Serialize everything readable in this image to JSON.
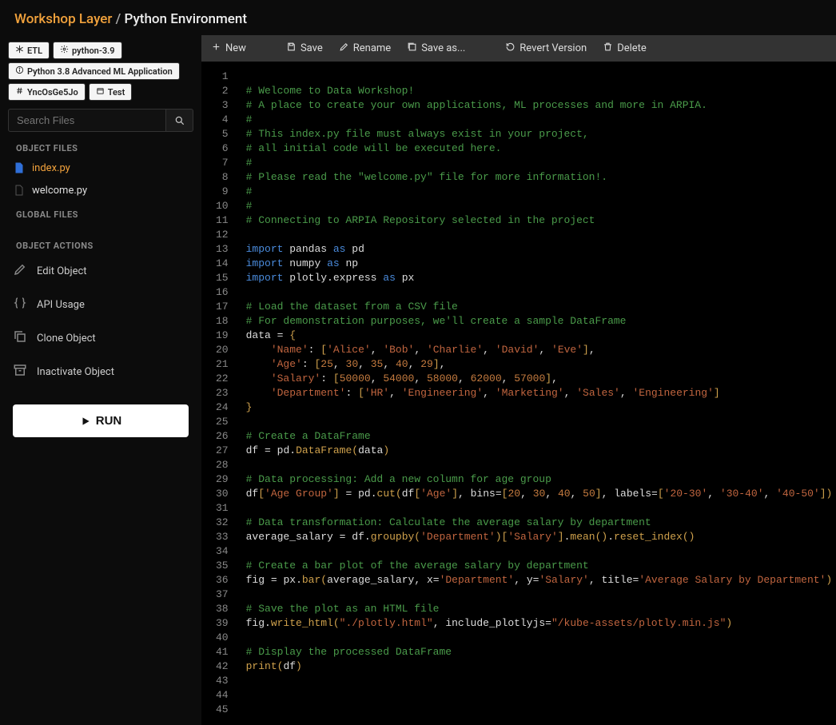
{
  "header": {
    "crumb1": "Workshop Layer",
    "crumb2": "Python Environment"
  },
  "tags": [
    {
      "icon": "snowflake",
      "label": "ETL"
    },
    {
      "icon": "gear",
      "label": "python-3.9"
    },
    {
      "icon": "info",
      "label": "Python 3.8 Advanced ML Application"
    },
    {
      "icon": "hash",
      "label": "YncOsGe5Jo"
    },
    {
      "icon": "box",
      "label": "Test"
    }
  ],
  "search": {
    "placeholder": "Search Files"
  },
  "sections": {
    "objectFiles": "Object Files",
    "globalFiles": "Global Files",
    "objectActions": "Object Actions"
  },
  "files": [
    {
      "name": "index.py",
      "active": true,
      "color": "#2f6fd8"
    },
    {
      "name": "welcome.py",
      "active": false,
      "color": "#555"
    }
  ],
  "actions": [
    {
      "icon": "pencil",
      "label": "Edit Object"
    },
    {
      "icon": "braces",
      "label": "API Usage"
    },
    {
      "icon": "copy",
      "label": "Clone Object"
    },
    {
      "icon": "archive",
      "label": "Inactivate Object"
    }
  ],
  "runLabel": "RUN",
  "toolbar": [
    {
      "icon": "plus",
      "label": "New"
    },
    {
      "icon": "save",
      "label": "Save"
    },
    {
      "icon": "pencil",
      "label": "Rename"
    },
    {
      "icon": "saveas",
      "label": "Save as..."
    },
    {
      "icon": "revert",
      "label": "Revert Version"
    },
    {
      "icon": "trash",
      "label": "Delete"
    }
  ],
  "code": [
    {
      "n": 1,
      "t": ""
    },
    {
      "n": 2,
      "t": "<span class='c-com'># Welcome to Data Workshop!</span>"
    },
    {
      "n": 3,
      "t": "<span class='c-com'># A place to create your own applications, ML processes and more in ARPIA.</span>"
    },
    {
      "n": 4,
      "t": "<span class='c-com'>#</span>"
    },
    {
      "n": 5,
      "t": "<span class='c-com'># This index.py file must always exist in your project,</span>"
    },
    {
      "n": 6,
      "t": "<span class='c-com'># all initial code will be executed here.</span>"
    },
    {
      "n": 7,
      "t": "<span class='c-com'>#</span>"
    },
    {
      "n": 8,
      "t": "<span class='c-com'># Please read the \"welcome.py\" file for more information!.</span>"
    },
    {
      "n": 9,
      "t": "<span class='c-com'>#</span>"
    },
    {
      "n": 10,
      "t": "<span class='c-com'>#</span>"
    },
    {
      "n": 11,
      "t": "<span class='c-com'># Connecting to ARPIA Repository selected in the project</span>"
    },
    {
      "n": 12,
      "t": ""
    },
    {
      "n": 13,
      "t": "<span class='c-key'>import</span> <span class='c-var'>pandas</span> <span class='c-key'>as</span> <span class='c-var'>pd</span>"
    },
    {
      "n": 14,
      "t": "<span class='c-key'>import</span> <span class='c-var'>numpy</span> <span class='c-key'>as</span> <span class='c-var'>np</span>"
    },
    {
      "n": 15,
      "t": "<span class='c-key'>import</span> <span class='c-var'>plotly</span><span class='c-op'>.</span><span class='c-var'>express</span> <span class='c-key'>as</span> <span class='c-var'>px</span>"
    },
    {
      "n": 16,
      "t": ""
    },
    {
      "n": 17,
      "t": "<span class='c-com'># Load the dataset from a CSV file</span>"
    },
    {
      "n": 18,
      "t": "<span class='c-com'># For demonstration purposes, we'll create a sample DataFrame</span>"
    },
    {
      "n": 19,
      "t": "<span class='c-var'>data</span> <span class='c-op'>=</span> <span class='c-fun'>{</span>"
    },
    {
      "n": 20,
      "t": "    <span class='c-str'>'Name'</span><span class='c-op'>:</span> <span class='c-fun'>[</span><span class='c-str'>'Alice'</span><span class='c-op'>,</span> <span class='c-str'>'Bob'</span><span class='c-op'>,</span> <span class='c-str'>'Charlie'</span><span class='c-op'>,</span> <span class='c-str'>'David'</span><span class='c-op'>,</span> <span class='c-str'>'Eve'</span><span class='c-fun'>]</span><span class='c-op'>,</span>"
    },
    {
      "n": 21,
      "t": "    <span class='c-str'>'Age'</span><span class='c-op'>:</span> <span class='c-fun'>[</span><span class='c-num'>25</span><span class='c-op'>,</span> <span class='c-num'>30</span><span class='c-op'>,</span> <span class='c-num'>35</span><span class='c-op'>,</span> <span class='c-num'>40</span><span class='c-op'>,</span> <span class='c-num'>29</span><span class='c-fun'>]</span><span class='c-op'>,</span>"
    },
    {
      "n": 22,
      "t": "    <span class='c-str'>'Salary'</span><span class='c-op'>:</span> <span class='c-fun'>[</span><span class='c-num'>50000</span><span class='c-op'>,</span> <span class='c-num'>54000</span><span class='c-op'>,</span> <span class='c-num'>58000</span><span class='c-op'>,</span> <span class='c-num'>62000</span><span class='c-op'>,</span> <span class='c-num'>57000</span><span class='c-fun'>]</span><span class='c-op'>,</span>"
    },
    {
      "n": 23,
      "t": "    <span class='c-str'>'Department'</span><span class='c-op'>:</span> <span class='c-fun'>[</span><span class='c-str'>'HR'</span><span class='c-op'>,</span> <span class='c-str'>'Engineering'</span><span class='c-op'>,</span> <span class='c-str'>'Marketing'</span><span class='c-op'>,</span> <span class='c-str'>'Sales'</span><span class='c-op'>,</span> <span class='c-str'>'Engineering'</span><span class='c-fun'>]</span>"
    },
    {
      "n": 24,
      "t": "<span class='c-fun'>}</span>"
    },
    {
      "n": 25,
      "t": ""
    },
    {
      "n": 26,
      "t": "<span class='c-com'># Create a DataFrame</span>"
    },
    {
      "n": 27,
      "t": "<span class='c-var'>df</span> <span class='c-op'>=</span> <span class='c-var'>pd</span><span class='c-op'>.</span><span class='c-fun'>DataFrame</span><span class='c-fun'>(</span><span class='c-var'>data</span><span class='c-fun'>)</span>"
    },
    {
      "n": 28,
      "t": ""
    },
    {
      "n": 29,
      "t": "<span class='c-com'># Data processing: Add a new column for age group</span>"
    },
    {
      "n": 30,
      "t": "<span class='c-var'>df</span><span class='c-fun'>[</span><span class='c-str'>'Age Group'</span><span class='c-fun'>]</span> <span class='c-op'>=</span> <span class='c-var'>pd</span><span class='c-op'>.</span><span class='c-fun'>cut</span><span class='c-fun'>(</span><span class='c-var'>df</span><span class='c-fun'>[</span><span class='c-str'>'Age'</span><span class='c-fun'>]</span><span class='c-op'>,</span> <span class='c-var'>bins</span><span class='c-op'>=</span><span class='c-fun'>[</span><span class='c-num'>20</span><span class='c-op'>,</span> <span class='c-num'>30</span><span class='c-op'>,</span> <span class='c-num'>40</span><span class='c-op'>,</span> <span class='c-num'>50</span><span class='c-fun'>]</span><span class='c-op'>,</span> <span class='c-var'>labels</span><span class='c-op'>=</span><span class='c-fun'>[</span><span class='c-str'>'20-30'</span><span class='c-op'>,</span> <span class='c-str'>'30-40'</span><span class='c-op'>,</span> <span class='c-str'>'40-50'</span><span class='c-fun'>])</span>"
    },
    {
      "n": 31,
      "t": ""
    },
    {
      "n": 32,
      "t": "<span class='c-com'># Data transformation: Calculate the average salary by department</span>"
    },
    {
      "n": 33,
      "t": "<span class='c-var'>average_salary</span> <span class='c-op'>=</span> <span class='c-var'>df</span><span class='c-op'>.</span><span class='c-fun'>groupby</span><span class='c-fun'>(</span><span class='c-str'>'Department'</span><span class='c-fun'>)[</span><span class='c-str'>'Salary'</span><span class='c-fun'>]</span><span class='c-op'>.</span><span class='c-fun'>mean</span><span class='c-fun'>()</span><span class='c-op'>.</span><span class='c-fun'>reset_index</span><span class='c-fun'>()</span>"
    },
    {
      "n": 34,
      "t": ""
    },
    {
      "n": 35,
      "t": "<span class='c-com'># Create a bar plot of the average salary by department</span>"
    },
    {
      "n": 36,
      "t": "<span class='c-var'>fig</span> <span class='c-op'>=</span> <span class='c-var'>px</span><span class='c-op'>.</span><span class='c-fun'>bar</span><span class='c-fun'>(</span><span class='c-var'>average_salary</span><span class='c-op'>,</span> <span class='c-var'>x</span><span class='c-op'>=</span><span class='c-str'>'Department'</span><span class='c-op'>,</span> <span class='c-var'>y</span><span class='c-op'>=</span><span class='c-str'>'Salary'</span><span class='c-op'>,</span> <span class='c-var'>title</span><span class='c-op'>=</span><span class='c-str'>'Average Salary by Department'</span><span class='c-fun'>)</span>"
    },
    {
      "n": 37,
      "t": ""
    },
    {
      "n": 38,
      "t": "<span class='c-com'># Save the plot as an HTML file</span>"
    },
    {
      "n": 39,
      "t": "<span class='c-var'>fig</span><span class='c-op'>.</span><span class='c-fun'>write_html</span><span class='c-fun'>(</span><span class='c-str'>\"./plotly.html\"</span><span class='c-op'>,</span> <span class='c-var'>include_plotlyjs</span><span class='c-op'>=</span><span class='c-str'>\"/kube-assets/plotly.min.js\"</span><span class='c-fun'>)</span>"
    },
    {
      "n": 40,
      "t": ""
    },
    {
      "n": 41,
      "t": "<span class='c-com'># Display the processed DataFrame</span>"
    },
    {
      "n": 42,
      "t": "<span class='c-fun'>print</span><span class='c-fun'>(</span><span class='c-var'>df</span><span class='c-fun'>)</span>"
    },
    {
      "n": 43,
      "t": ""
    },
    {
      "n": 44,
      "t": ""
    },
    {
      "n": 45,
      "t": ""
    }
  ]
}
